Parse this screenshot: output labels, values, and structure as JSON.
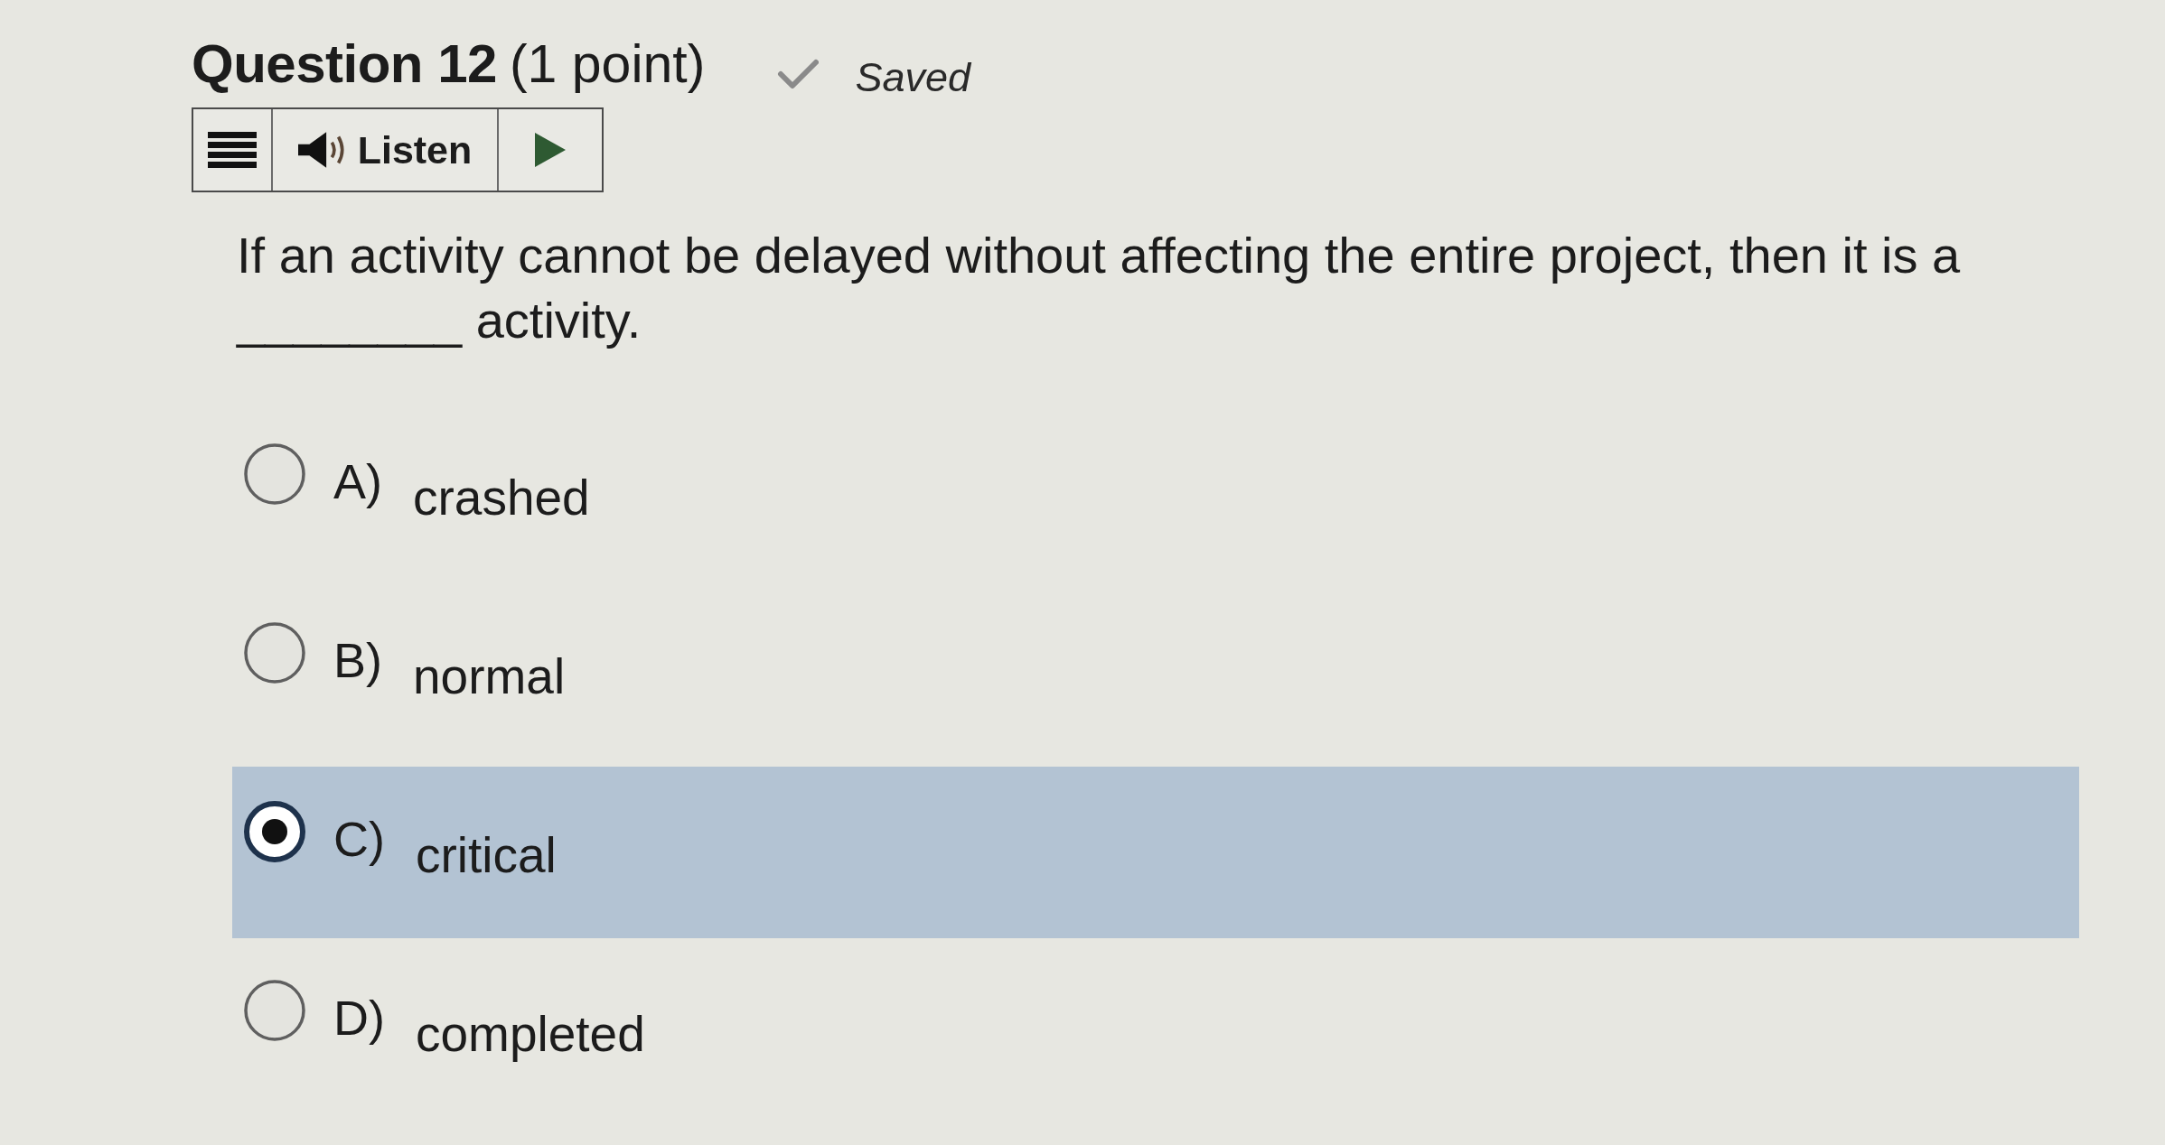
{
  "header": {
    "title": "Question 12",
    "points": "(1 point)",
    "status": "Saved"
  },
  "toolbar": {
    "listen_label": "Listen"
  },
  "prompt": "If an activity cannot be delayed without affecting the entire project, then it is a ________ activity.",
  "options": [
    {
      "letter": "A)",
      "text": "crashed",
      "selected": false
    },
    {
      "letter": "B)",
      "text": "normal",
      "selected": false
    },
    {
      "letter": "C)",
      "text": "critical",
      "selected": true
    },
    {
      "letter": "D)",
      "text": "completed",
      "selected": false
    }
  ]
}
